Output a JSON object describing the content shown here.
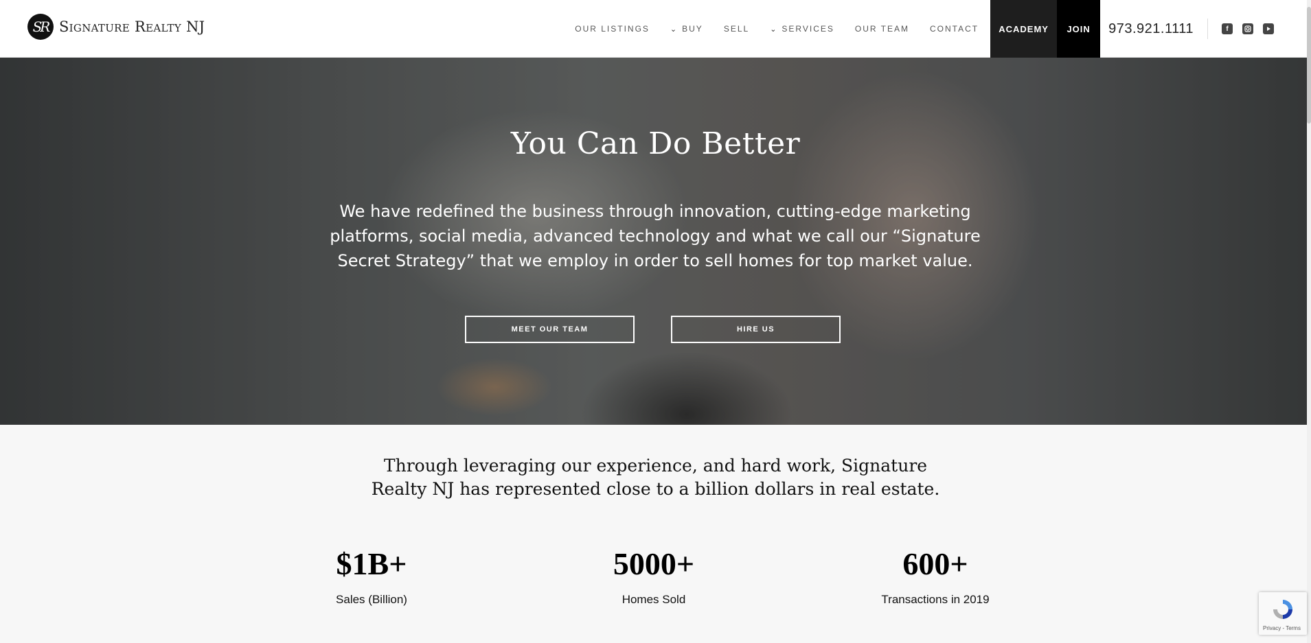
{
  "header": {
    "logo_mark": "SR",
    "logo_text": "Signature Realty NJ",
    "nav": [
      {
        "label": "Our Listings",
        "dropdown": false
      },
      {
        "label": "Buy",
        "dropdown": true
      },
      {
        "label": "Sell",
        "dropdown": false
      },
      {
        "label": "Services",
        "dropdown": true
      },
      {
        "label": "Our Team",
        "dropdown": false
      },
      {
        "label": "Contact",
        "dropdown": false
      }
    ],
    "academy_label": "Academy",
    "join_label": "Join",
    "phone": "973.921.1111",
    "social_icons": [
      "facebook-icon",
      "instagram-icon",
      "youtube-icon"
    ]
  },
  "hero": {
    "title": "You Can Do Better",
    "text": "We have redefined the business through innovation, cutting-edge marketing platforms, social media, advanced technology and what we call our “Signature Secret Strategy” that we employ in order to sell homes for top market value.",
    "meet_team_label": "Meet Our Team",
    "hire_us_label": "Hire Us"
  },
  "intro": {
    "line1": "Through leveraging our experience, and hard work, Signature",
    "line2": "Realty NJ has represented close to a billion dollars in real estate."
  },
  "stats": [
    {
      "value": "$1B+",
      "label": "Sales (Billion)"
    },
    {
      "value": "5000+",
      "label": "Homes Sold"
    },
    {
      "value": "600+",
      "label": "Transactions in 2019"
    }
  ],
  "recaptcha": {
    "text": "Privacy - Terms"
  },
  "colors": {
    "dark_button": "#1e1e1e",
    "join_button": "#000000",
    "background": "#f7f7f7"
  }
}
